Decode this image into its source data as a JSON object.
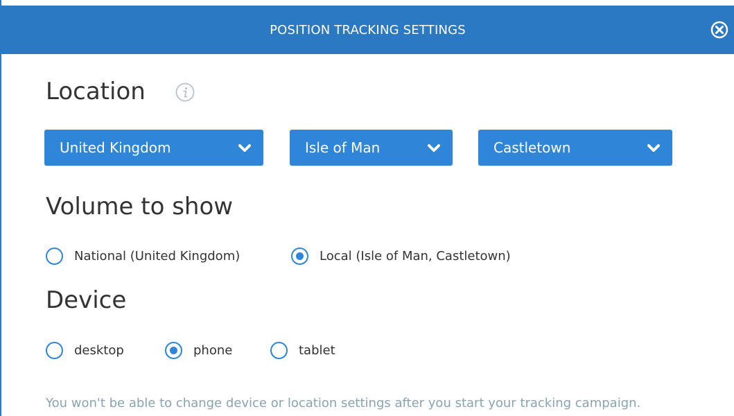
{
  "header": {
    "title": "POSITION TRACKING SETTINGS",
    "close_icon": "close-circle-icon"
  },
  "location": {
    "title": "Location",
    "info_icon": "info-icon",
    "country": "United Kingdom",
    "region": "Isle of Man",
    "city": "Castletown"
  },
  "volume": {
    "title": "Volume to show",
    "options": [
      {
        "label": "National (United Kingdom)",
        "selected": false
      },
      {
        "label": "Local (Isle of Man, Castletown)",
        "selected": true
      }
    ]
  },
  "device": {
    "title": "Device",
    "options": [
      {
        "label": "desktop",
        "selected": false
      },
      {
        "label": "phone",
        "selected": true
      },
      {
        "label": "tablet",
        "selected": false
      }
    ]
  },
  "note": "You won't be able to change device or location settings after you start your tracking campaign.",
  "colors": {
    "header_bg": "#2b79c2",
    "accent": "#2f86d8",
    "note_text": "#8aa3b2"
  }
}
